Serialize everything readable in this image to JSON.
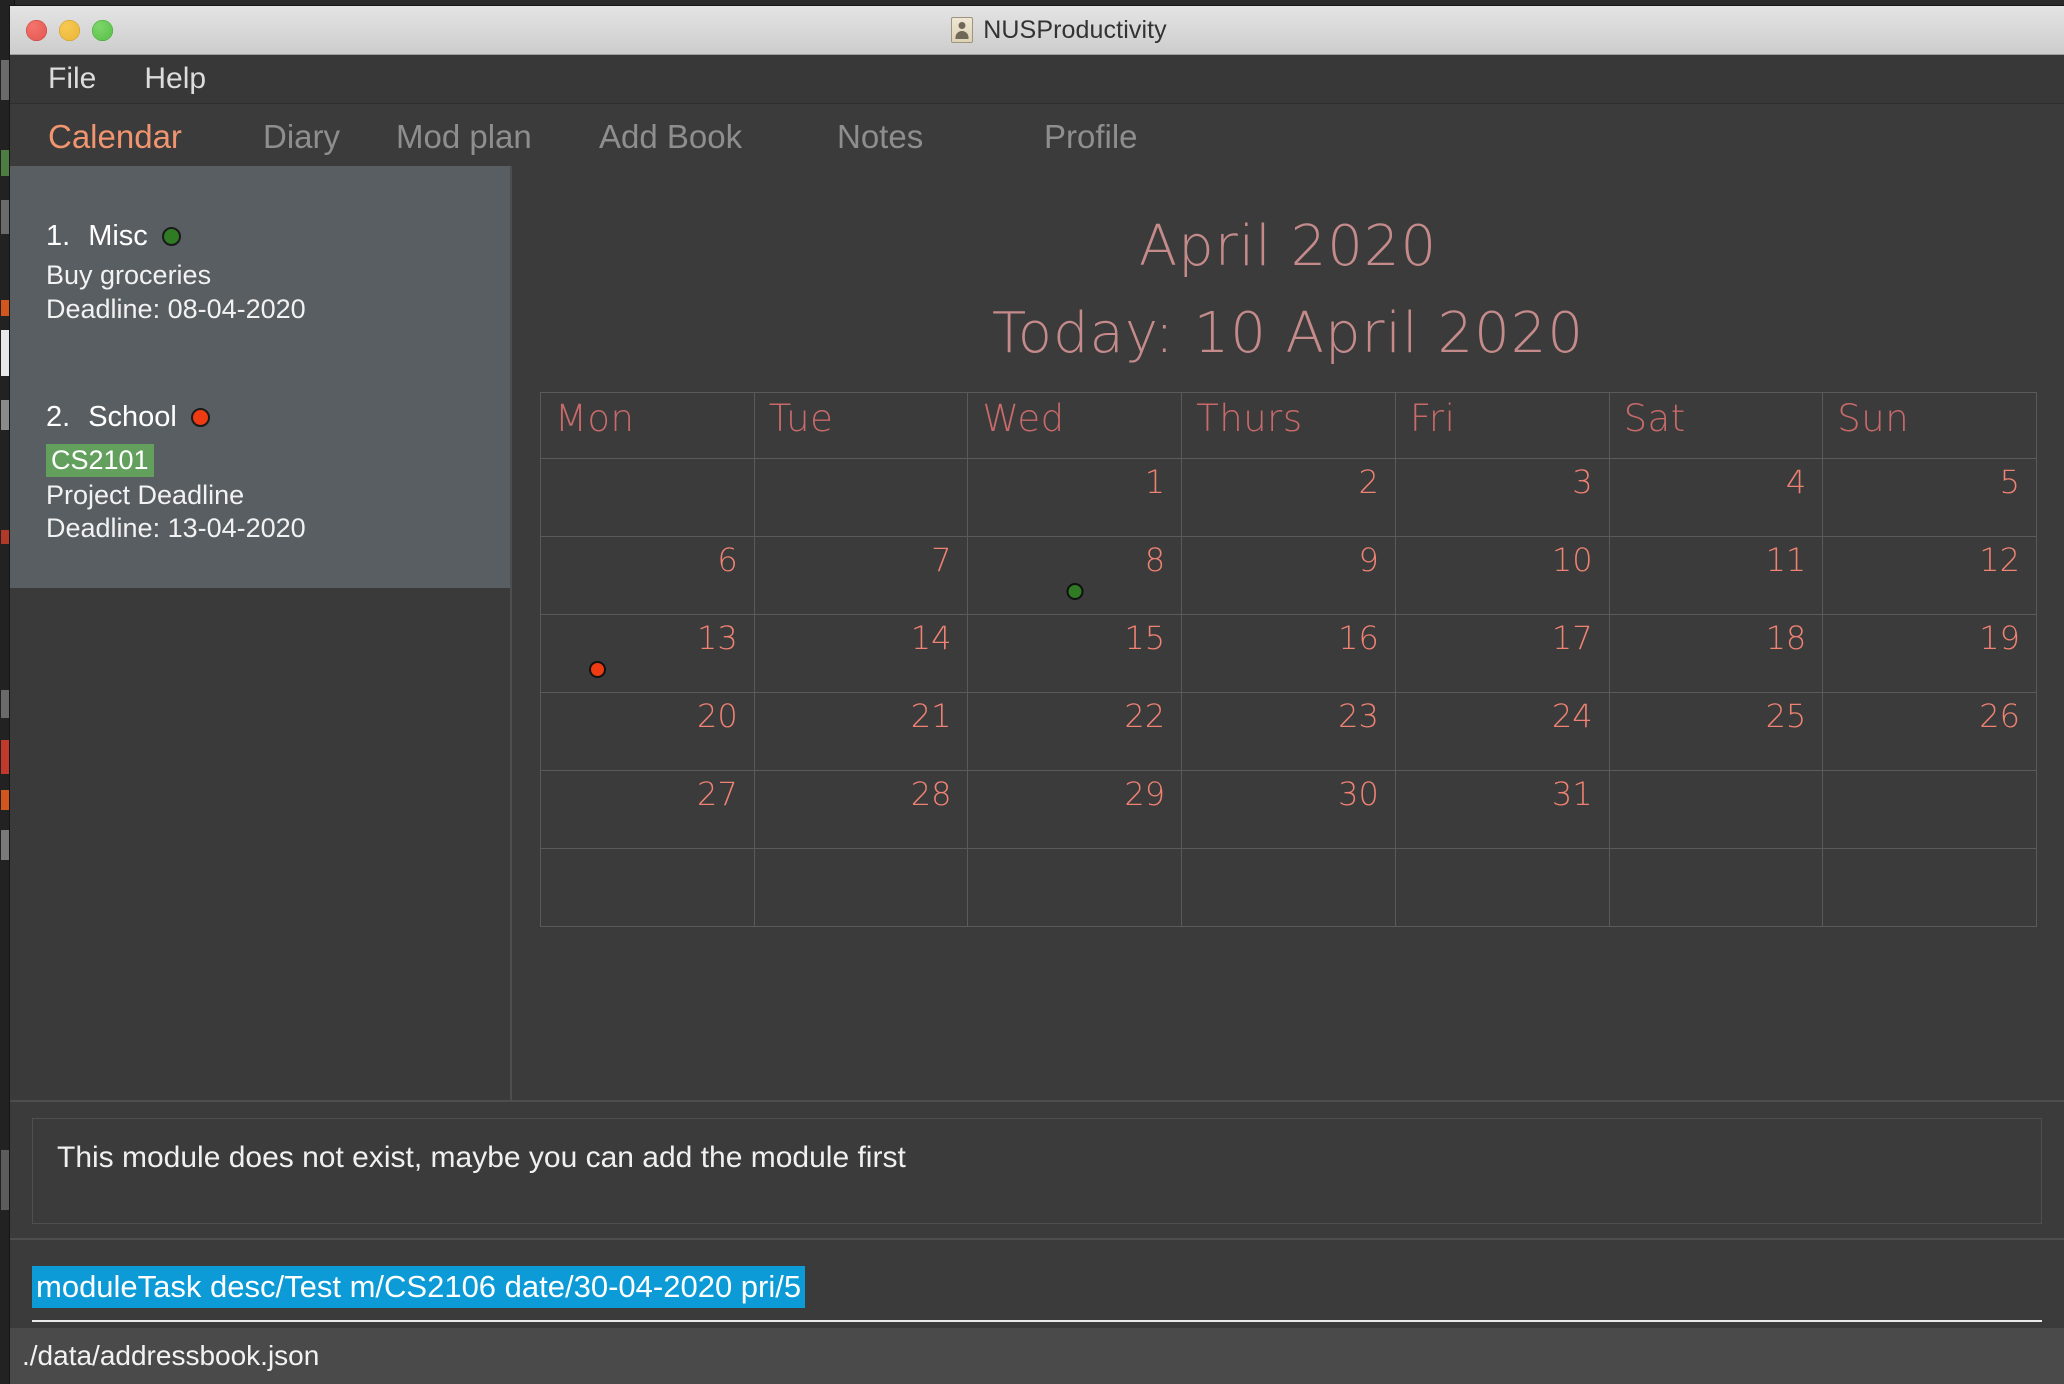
{
  "window": {
    "title": "NUSProductivity",
    "icon": "address-book-person-icon",
    "traffic_lights": {
      "close": "#e0564f",
      "minimize": "#e8b534",
      "maximize": "#54bf46"
    }
  },
  "menubar": {
    "items": [
      {
        "label": "File"
      },
      {
        "label": "Help"
      }
    ]
  },
  "tabs": [
    {
      "label": "Calendar",
      "active": true
    },
    {
      "label": "Diary",
      "active": false
    },
    {
      "label": "Mod plan",
      "active": false
    },
    {
      "label": "Add Book",
      "active": false
    },
    {
      "label": "Notes",
      "active": false
    },
    {
      "label": "Profile",
      "active": false
    }
  ],
  "tasks": [
    {
      "index": "1.",
      "title": "Misc",
      "priority_color": "#2f7a22",
      "tag": null,
      "description": "Buy groceries",
      "deadline": "Deadline: 08-04-2020"
    },
    {
      "index": "2.",
      "title": "School",
      "priority_color": "#ee3b12",
      "tag": "CS2101",
      "description": "Project Deadline",
      "deadline": "Deadline: 13-04-2020"
    }
  ],
  "calendar": {
    "month_title": "April 2020",
    "today_title": "Today: 10 April 2020",
    "weekday_headers": [
      "Mon",
      "Tue",
      "Wed",
      "Thurs",
      "Fri",
      "Sat",
      "Sun"
    ],
    "weeks": [
      [
        "",
        "",
        "1",
        "2",
        "3",
        "4",
        "5"
      ],
      [
        "6",
        "7",
        "8",
        "9",
        "10",
        "11",
        "12"
      ],
      [
        "13",
        "14",
        "15",
        "16",
        "17",
        "18",
        "19"
      ],
      [
        "20",
        "21",
        "22",
        "23",
        "24",
        "25",
        "26"
      ],
      [
        "27",
        "28",
        "29",
        "30",
        "31",
        "",
        ""
      ],
      [
        "",
        "",
        "",
        "",
        "",
        "",
        ""
      ]
    ],
    "markers": [
      {
        "week": 1,
        "day_index": 2,
        "day": "8",
        "color": "#2f7a22",
        "align": "center"
      },
      {
        "week": 2,
        "day_index": 0,
        "day": "13",
        "color": "#ee3b12",
        "align": "left"
      }
    ],
    "header_color": "#c86a6a",
    "number_color": "#ef8273",
    "title_color": "#c58b8b"
  },
  "result": {
    "message": "This module does not exist, maybe you can add the module first"
  },
  "command": {
    "value": "moduleTask desc/Test m/CS2106 date/30-04-2020 pri/5",
    "selected": true,
    "selection_color": "#0c9bd7"
  },
  "statusbar": {
    "path": "./data/addressbook.json"
  }
}
